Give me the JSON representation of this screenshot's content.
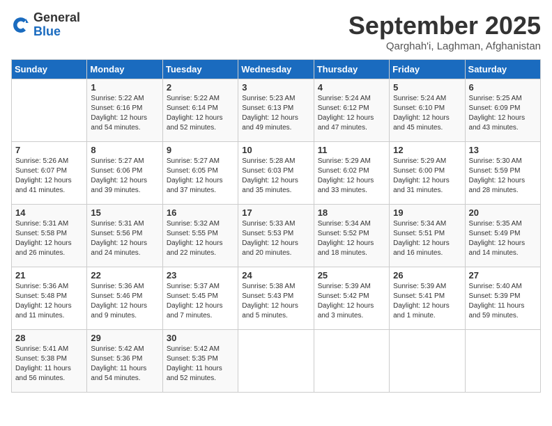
{
  "logo": {
    "general": "General",
    "blue": "Blue"
  },
  "title": "September 2025",
  "location": "Qarghah'i, Laghman, Afghanistan",
  "weekdays": [
    "Sunday",
    "Monday",
    "Tuesday",
    "Wednesday",
    "Thursday",
    "Friday",
    "Saturday"
  ],
  "weeks": [
    [
      {
        "day": "",
        "info": ""
      },
      {
        "day": "1",
        "info": "Sunrise: 5:22 AM\nSunset: 6:16 PM\nDaylight: 12 hours\nand 54 minutes."
      },
      {
        "day": "2",
        "info": "Sunrise: 5:22 AM\nSunset: 6:14 PM\nDaylight: 12 hours\nand 52 minutes."
      },
      {
        "day": "3",
        "info": "Sunrise: 5:23 AM\nSunset: 6:13 PM\nDaylight: 12 hours\nand 49 minutes."
      },
      {
        "day": "4",
        "info": "Sunrise: 5:24 AM\nSunset: 6:12 PM\nDaylight: 12 hours\nand 47 minutes."
      },
      {
        "day": "5",
        "info": "Sunrise: 5:24 AM\nSunset: 6:10 PM\nDaylight: 12 hours\nand 45 minutes."
      },
      {
        "day": "6",
        "info": "Sunrise: 5:25 AM\nSunset: 6:09 PM\nDaylight: 12 hours\nand 43 minutes."
      }
    ],
    [
      {
        "day": "7",
        "info": "Sunrise: 5:26 AM\nSunset: 6:07 PM\nDaylight: 12 hours\nand 41 minutes."
      },
      {
        "day": "8",
        "info": "Sunrise: 5:27 AM\nSunset: 6:06 PM\nDaylight: 12 hours\nand 39 minutes."
      },
      {
        "day": "9",
        "info": "Sunrise: 5:27 AM\nSunset: 6:05 PM\nDaylight: 12 hours\nand 37 minutes."
      },
      {
        "day": "10",
        "info": "Sunrise: 5:28 AM\nSunset: 6:03 PM\nDaylight: 12 hours\nand 35 minutes."
      },
      {
        "day": "11",
        "info": "Sunrise: 5:29 AM\nSunset: 6:02 PM\nDaylight: 12 hours\nand 33 minutes."
      },
      {
        "day": "12",
        "info": "Sunrise: 5:29 AM\nSunset: 6:00 PM\nDaylight: 12 hours\nand 31 minutes."
      },
      {
        "day": "13",
        "info": "Sunrise: 5:30 AM\nSunset: 5:59 PM\nDaylight: 12 hours\nand 28 minutes."
      }
    ],
    [
      {
        "day": "14",
        "info": "Sunrise: 5:31 AM\nSunset: 5:58 PM\nDaylight: 12 hours\nand 26 minutes."
      },
      {
        "day": "15",
        "info": "Sunrise: 5:31 AM\nSunset: 5:56 PM\nDaylight: 12 hours\nand 24 minutes."
      },
      {
        "day": "16",
        "info": "Sunrise: 5:32 AM\nSunset: 5:55 PM\nDaylight: 12 hours\nand 22 minutes."
      },
      {
        "day": "17",
        "info": "Sunrise: 5:33 AM\nSunset: 5:53 PM\nDaylight: 12 hours\nand 20 minutes."
      },
      {
        "day": "18",
        "info": "Sunrise: 5:34 AM\nSunset: 5:52 PM\nDaylight: 12 hours\nand 18 minutes."
      },
      {
        "day": "19",
        "info": "Sunrise: 5:34 AM\nSunset: 5:51 PM\nDaylight: 12 hours\nand 16 minutes."
      },
      {
        "day": "20",
        "info": "Sunrise: 5:35 AM\nSunset: 5:49 PM\nDaylight: 12 hours\nand 14 minutes."
      }
    ],
    [
      {
        "day": "21",
        "info": "Sunrise: 5:36 AM\nSunset: 5:48 PM\nDaylight: 12 hours\nand 11 minutes."
      },
      {
        "day": "22",
        "info": "Sunrise: 5:36 AM\nSunset: 5:46 PM\nDaylight: 12 hours\nand 9 minutes."
      },
      {
        "day": "23",
        "info": "Sunrise: 5:37 AM\nSunset: 5:45 PM\nDaylight: 12 hours\nand 7 minutes."
      },
      {
        "day": "24",
        "info": "Sunrise: 5:38 AM\nSunset: 5:43 PM\nDaylight: 12 hours\nand 5 minutes."
      },
      {
        "day": "25",
        "info": "Sunrise: 5:39 AM\nSunset: 5:42 PM\nDaylight: 12 hours\nand 3 minutes."
      },
      {
        "day": "26",
        "info": "Sunrise: 5:39 AM\nSunset: 5:41 PM\nDaylight: 12 hours\nand 1 minute."
      },
      {
        "day": "27",
        "info": "Sunrise: 5:40 AM\nSunset: 5:39 PM\nDaylight: 11 hours\nand 59 minutes."
      }
    ],
    [
      {
        "day": "28",
        "info": "Sunrise: 5:41 AM\nSunset: 5:38 PM\nDaylight: 11 hours\nand 56 minutes."
      },
      {
        "day": "29",
        "info": "Sunrise: 5:42 AM\nSunset: 5:36 PM\nDaylight: 11 hours\nand 54 minutes."
      },
      {
        "day": "30",
        "info": "Sunrise: 5:42 AM\nSunset: 5:35 PM\nDaylight: 11 hours\nand 52 minutes."
      },
      {
        "day": "",
        "info": ""
      },
      {
        "day": "",
        "info": ""
      },
      {
        "day": "",
        "info": ""
      },
      {
        "day": "",
        "info": ""
      }
    ]
  ]
}
